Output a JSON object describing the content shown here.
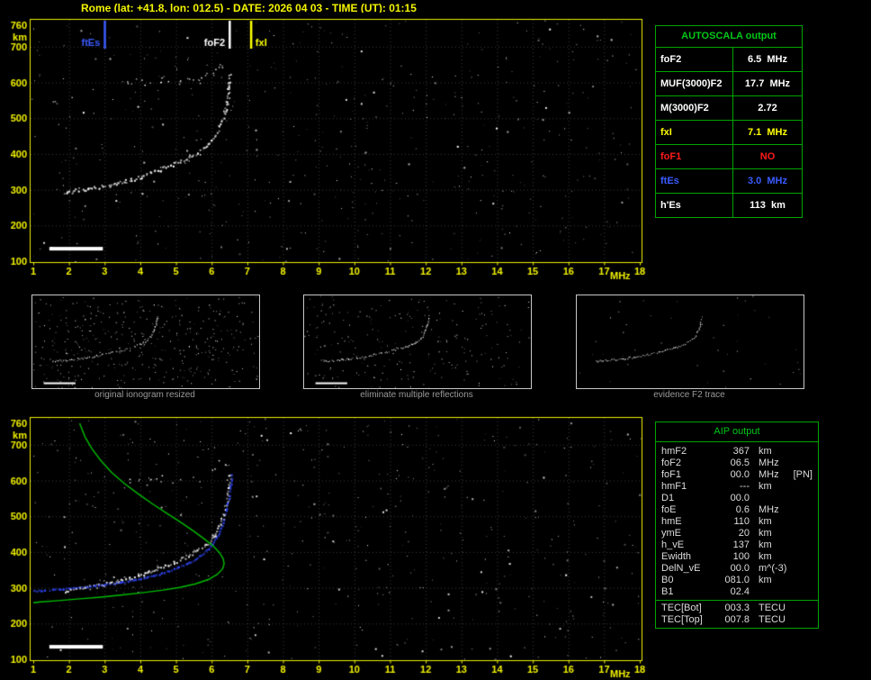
{
  "title": "Rome (lat: +41.8, lon: 012.5) - DATE: 2026 04 03 - TIME (UT): 01:15",
  "colors": {
    "background": "#000000",
    "axis": "#f0f000",
    "grid": "#3a3a3a",
    "trace": "#ffffff",
    "table_green": "#00a400",
    "title_green": "#00c818",
    "blue": "#3a5bff",
    "red": "#ff1a1a",
    "profile_green": "#00bb00",
    "fit_blue": "#2f46ff",
    "caption_gray": "#9a9a9a"
  },
  "autoscala_table": {
    "title": "AUTOSCALA output",
    "rows": [
      {
        "name": "foF2",
        "value": "6.5",
        "unit": "MHz",
        "color": "#ffffff"
      },
      {
        "name": "MUF(3000)F2",
        "value": "17.7",
        "unit": "MHz",
        "color": "#ffffff"
      },
      {
        "name": "M(3000)F2",
        "value": "2.72",
        "unit": "",
        "color": "#ffffff"
      },
      {
        "name": "fxI",
        "value": "7.1",
        "unit": "MHz",
        "color": "#ffff00"
      },
      {
        "name": "foF1",
        "value": "NO",
        "unit": "",
        "color": "#ff1a1a"
      },
      {
        "name": "ftEs",
        "value": "3.0",
        "unit": "MHz",
        "color": "#3a5bff"
      },
      {
        "name": "h'Es",
        "value": "113",
        "unit": "km",
        "color": "#ffffff"
      }
    ]
  },
  "aip_table": {
    "title": "AIP output",
    "rows": [
      {
        "name": "hmF2",
        "value": "367",
        "unit": "km",
        "extra": ""
      },
      {
        "name": "foF2",
        "value": "06.5",
        "unit": "MHz",
        "extra": ""
      },
      {
        "name": "foF1",
        "value": "00.0",
        "unit": "MHz",
        "extra": "[PN]"
      },
      {
        "name": "hmF1",
        "value": "---",
        "unit": "km",
        "extra": ""
      },
      {
        "name": "D1",
        "value": "00.0",
        "unit": "",
        "extra": ""
      },
      {
        "name": "foE",
        "value": "0.6",
        "unit": "MHz",
        "extra": ""
      },
      {
        "name": "hmE",
        "value": "110",
        "unit": "km",
        "extra": ""
      },
      {
        "name": "ymE",
        "value": "20",
        "unit": "km",
        "extra": ""
      },
      {
        "name": "h_vE",
        "value": "137",
        "unit": "km",
        "extra": ""
      },
      {
        "name": "Ewidth",
        "value": "100",
        "unit": "km",
        "extra": ""
      },
      {
        "name": "DelN_vE",
        "value": "00.0",
        "unit": "m^(-3)",
        "extra": ""
      },
      {
        "name": "B0",
        "value": "081.0",
        "unit": "km",
        "extra": ""
      },
      {
        "name": "B1",
        "value": "02.4",
        "unit": "",
        "extra": ""
      }
    ],
    "tec_rows": [
      {
        "name": "TEC[Bot]",
        "value": "003.3",
        "unit": "TECU"
      },
      {
        "name": "TEC[Top]",
        "value": "007.8",
        "unit": "TECU"
      }
    ]
  },
  "thumbnails": [
    {
      "caption": "original ionogram resized",
      "noise": 420,
      "show_es": true
    },
    {
      "caption": "eliminate multiple reflections",
      "noise": 240,
      "show_es": true
    },
    {
      "caption": "evidence F2 trace",
      "noise": 45,
      "show_es": false
    }
  ],
  "chart_data": [
    {
      "id": "top_ionogram",
      "type": "scatter",
      "title": "autoscaled ionogram",
      "xlabel": "MHz",
      "ylabel": "km",
      "xlim": [
        1,
        18
      ],
      "ylim": [
        100,
        760
      ],
      "x_ticks": [
        1,
        2,
        3,
        4,
        5,
        6,
        7,
        8,
        9,
        10,
        11,
        12,
        13,
        14,
        15,
        16,
        17,
        18
      ],
      "y_ticks": [
        760,
        700,
        600,
        500,
        400,
        300,
        200,
        100
      ],
      "grid": "dotted",
      "markers": [
        {
          "label": "ftEs",
          "freq": 3.0,
          "color": "#3a5bff",
          "label_side": "left"
        },
        {
          "label": "foF2",
          "freq": 6.5,
          "color": "#ffffff",
          "label_side": "left"
        },
        {
          "label": "fxI",
          "freq": 7.1,
          "color": "#ffff00",
          "label_side": "right"
        }
      ],
      "series": [
        {
          "name": "F2 trace",
          "kind": "trace",
          "color": "#ffffff",
          "points": [
            [
              1.85,
              293
            ],
            [
              2.1,
              298
            ],
            [
              2.35,
              301
            ],
            [
              2.6,
              305
            ],
            [
              2.85,
              309
            ],
            [
              3.1,
              314
            ],
            [
              3.35,
              320
            ],
            [
              3.6,
              326
            ],
            [
              3.85,
              333
            ],
            [
              4.1,
              341
            ],
            [
              4.35,
              350
            ],
            [
              4.6,
              359
            ],
            [
              4.85,
              369
            ],
            [
              5.1,
              380
            ],
            [
              5.35,
              392
            ],
            [
              5.6,
              406
            ],
            [
              5.8,
              420
            ],
            [
              5.95,
              434
            ],
            [
              6.1,
              452
            ],
            [
              6.2,
              472
            ],
            [
              6.3,
              497
            ],
            [
              6.38,
              527
            ],
            [
              6.44,
              560
            ],
            [
              6.48,
              595
            ],
            [
              6.5,
              625
            ]
          ]
        },
        {
          "name": "F2 second reflection",
          "kind": "dots",
          "color": "#ffffff",
          "points": [
            [
              3.7,
              598
            ],
            [
              3.95,
              604
            ],
            [
              4.2,
              596
            ],
            [
              4.5,
              607
            ],
            [
              4.75,
              612
            ],
            [
              5.0,
              601
            ],
            [
              5.3,
              615
            ],
            [
              5.55,
              606
            ],
            [
              5.8,
              622
            ],
            [
              6.0,
              630
            ],
            [
              6.15,
              640
            ],
            [
              6.3,
              650
            ],
            [
              2.1,
              560
            ],
            [
              1.6,
              545
            ]
          ]
        },
        {
          "name": "Es trace h'Es",
          "kind": "bar",
          "color": "#ffffff",
          "points": [
            [
              1.45,
              135
            ],
            [
              2.95,
              135
            ]
          ]
        }
      ]
    },
    {
      "id": "bottom_ionogram_aip",
      "type": "line",
      "title": "ionogram with restored trace and electron density profile",
      "xlabel": "MHz",
      "ylabel": "km",
      "xlim": [
        1,
        18
      ],
      "ylim": [
        100,
        760
      ],
      "x_ticks": [
        1,
        2,
        3,
        4,
        5,
        6,
        7,
        8,
        9,
        10,
        11,
        12,
        13,
        14,
        15,
        16,
        17,
        18
      ],
      "y_ticks": [
        760,
        700,
        600,
        500,
        400,
        300,
        200,
        100
      ],
      "grid": "dotted",
      "series": [
        {
          "name": "F2 trace",
          "kind": "trace",
          "color": "#ffffff",
          "points": [
            [
              1.85,
              293
            ],
            [
              2.1,
              298
            ],
            [
              2.35,
              301
            ],
            [
              2.6,
              305
            ],
            [
              2.85,
              309
            ],
            [
              3.1,
              314
            ],
            [
              3.35,
              320
            ],
            [
              3.6,
              326
            ],
            [
              3.85,
              333
            ],
            [
              4.1,
              341
            ],
            [
              4.35,
              350
            ],
            [
              4.6,
              359
            ],
            [
              4.85,
              369
            ],
            [
              5.1,
              380
            ],
            [
              5.35,
              392
            ],
            [
              5.6,
              406
            ],
            [
              5.8,
              420
            ],
            [
              5.95,
              434
            ],
            [
              6.1,
              452
            ],
            [
              6.2,
              472
            ],
            [
              6.3,
              497
            ],
            [
              6.38,
              527
            ],
            [
              6.44,
              560
            ],
            [
              6.48,
              595
            ],
            [
              6.5,
              625
            ]
          ]
        },
        {
          "name": "F2 second reflection",
          "kind": "dots",
          "color": "#ffffff",
          "points": [
            [
              3.7,
              598
            ],
            [
              3.95,
              604
            ],
            [
              4.2,
              596
            ],
            [
              4.5,
              607
            ],
            [
              5.0,
              601
            ],
            [
              5.55,
              606
            ],
            [
              6.0,
              630
            ],
            [
              6.3,
              650
            ]
          ]
        },
        {
          "name": "Es trace h'Es",
          "kind": "bar",
          "color": "#ffffff",
          "points": [
            [
              1.45,
              135
            ],
            [
              2.95,
              135
            ]
          ]
        },
        {
          "name": "restored trace fit",
          "kind": "dotline",
          "color": "#2f46ff",
          "points": [
            [
              1.0,
              293
            ],
            [
              1.6,
              297
            ],
            [
              2.2,
              302
            ],
            [
              2.8,
              308
            ],
            [
              3.4,
              316
            ],
            [
              4.0,
              327
            ],
            [
              4.5,
              340
            ],
            [
              5.0,
              357
            ],
            [
              5.4,
              375
            ],
            [
              5.7,
              394
            ],
            [
              5.9,
              412
            ],
            [
              6.08,
              436
            ],
            [
              6.22,
              462
            ],
            [
              6.33,
              492
            ],
            [
              6.41,
              525
            ],
            [
              6.47,
              558
            ],
            [
              6.52,
              592
            ],
            [
              6.56,
              625
            ]
          ]
        },
        {
          "name": "electron density profile",
          "kind": "line",
          "color": "#00bb00",
          "points": [
            [
              2.3,
              760
            ],
            [
              2.45,
              722
            ],
            [
              2.65,
              688
            ],
            [
              2.9,
              655
            ],
            [
              3.2,
              622
            ],
            [
              3.55,
              592
            ],
            [
              3.95,
              562
            ],
            [
              4.35,
              534
            ],
            [
              4.75,
              508
            ],
            [
              5.15,
              482
            ],
            [
              5.5,
              458
            ],
            [
              5.8,
              436
            ],
            [
              6.05,
              416
            ],
            [
              6.22,
              398
            ],
            [
              6.32,
              382
            ],
            [
              6.35,
              367
            ],
            [
              6.3,
              352
            ],
            [
              6.15,
              337
            ],
            [
              5.9,
              323
            ],
            [
              5.55,
              311
            ],
            [
              5.1,
              301
            ],
            [
              4.6,
              293
            ],
            [
              4.05,
              286
            ],
            [
              3.5,
              280
            ],
            [
              2.9,
              274
            ],
            [
              2.3,
              269
            ],
            [
              1.7,
              264
            ],
            [
              1.15,
              260
            ],
            [
              1.0,
              258
            ]
          ]
        }
      ]
    }
  ]
}
